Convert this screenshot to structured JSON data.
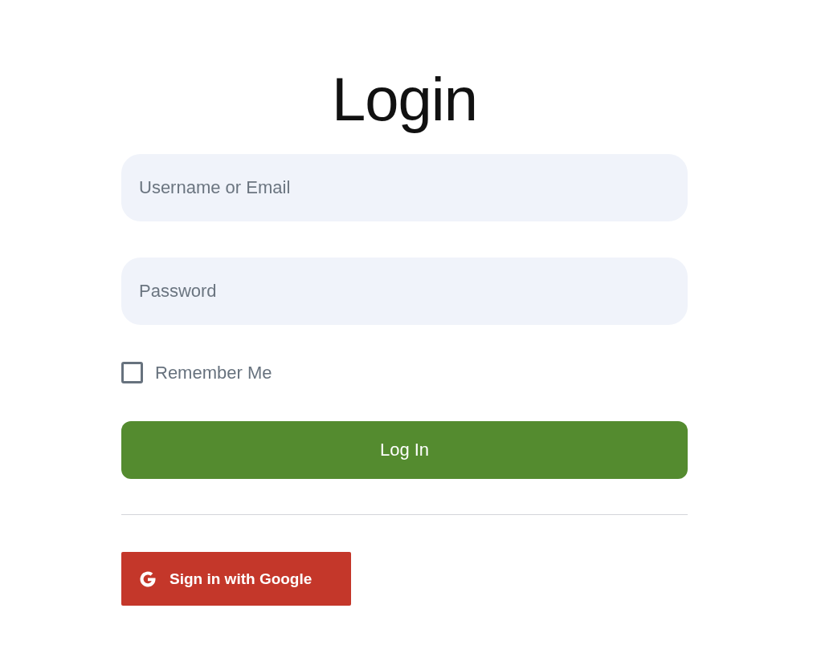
{
  "title": "Login",
  "fields": [
    {
      "placeholder": "Username or Email"
    },
    {
      "placeholder": "Password"
    }
  ],
  "remember": {
    "label": "Remember Me",
    "checked": false
  },
  "login_button": "Log In",
  "google_button": "Sign in with Google"
}
